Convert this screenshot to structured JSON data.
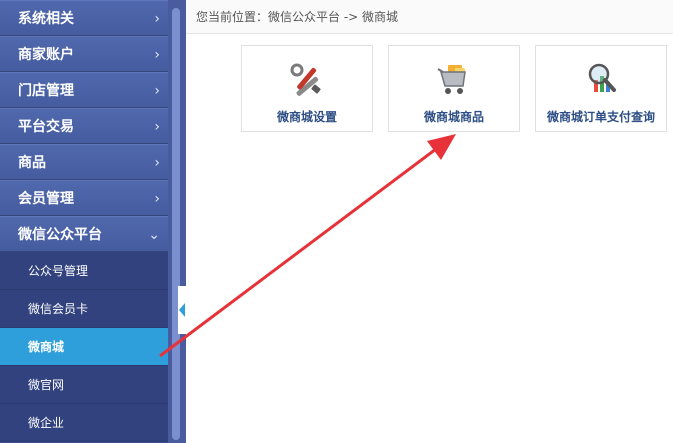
{
  "sidebar": {
    "items": [
      {
        "label": "系统相关"
      },
      {
        "label": "商家账户"
      },
      {
        "label": "门店管理"
      },
      {
        "label": "平台交易"
      },
      {
        "label": "商品"
      },
      {
        "label": "会员管理"
      },
      {
        "label": "微信公众平台"
      }
    ],
    "chevron": "›",
    "chevron_down": "⌄",
    "sub_items": [
      {
        "label": "公众号管理"
      },
      {
        "label": "微信会员卡"
      },
      {
        "label": "微商城"
      },
      {
        "label": "微官网"
      },
      {
        "label": "微企业"
      }
    ]
  },
  "breadcrumb": "您当前位置：微信公众平台 -> 微商城",
  "tiles": [
    {
      "label": "微商城设置",
      "icon": "tools-icon"
    },
    {
      "label": "微商城商品",
      "icon": "shopping-cart-icon"
    },
    {
      "label": "微商城订单支付查询",
      "icon": "magnifier-chart-icon"
    }
  ],
  "colors": {
    "sidebar": "#455c9f",
    "active": "#2f9fdc",
    "arrow": "#e8323a"
  }
}
